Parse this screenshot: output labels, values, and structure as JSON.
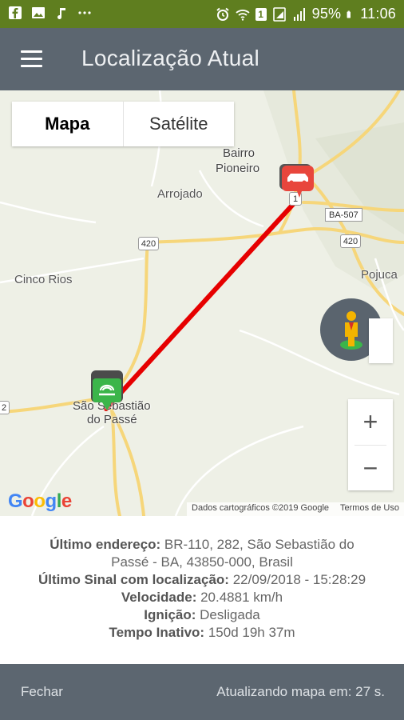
{
  "status_bar": {
    "battery": "95%",
    "time": "11:06",
    "sim_slot": "1",
    "icons": [
      "facebook-icon",
      "photo-icon",
      "music-icon",
      "more-icon",
      "alarm-icon",
      "wifi-calling-icon",
      "sim-icon",
      "signal-icon",
      "battery-icon"
    ]
  },
  "app_bar": {
    "title": "Localização Atual",
    "menu_icon": "hamburger-menu-icon"
  },
  "map": {
    "map_types": [
      "Mapa",
      "Satélite"
    ],
    "selected_map_type": "Mapa",
    "places": [
      "Bairro",
      "Pioneiro",
      "Arrojado",
      "Cinco Rios",
      "São Sebastião",
      "do Passé",
      "Pojuca"
    ],
    "road_shields": [
      "420",
      "420",
      "BA-507",
      "420",
      "2",
      "1"
    ],
    "markers": [
      {
        "name": "vehicle-current-marker",
        "color": "#e8463c"
      },
      {
        "name": "signal-marker",
        "color": "#3bb54a"
      }
    ],
    "route_color": "#e60000",
    "zoom_in": "+",
    "zoom_out": "−",
    "google_logo": "Google",
    "attribution": "Dados cartográficos ©2019 Google",
    "terms": "Termos de Uso"
  },
  "info": {
    "last_address_label": "Último endereço:",
    "last_address_value_1": "BR-110, 282, São Sebastião do",
    "last_address_value_2": "Passé - BA, 43850-000, Brasil",
    "last_signal_label": "Último Sinal com localização:",
    "last_signal_value": "22/09/2018 - 15:28:29",
    "speed_label": "Velocidade:",
    "speed_value": "20.4881 km/h",
    "ignition_label": "Ignição:",
    "ignition_value": "Desligada",
    "idle_label": "Tempo Inativo:",
    "idle_value": "150d 19h 37m"
  },
  "bottom_bar": {
    "close_label": "Fechar",
    "refresh_text": "Atualizando mapa em: 27 s."
  }
}
